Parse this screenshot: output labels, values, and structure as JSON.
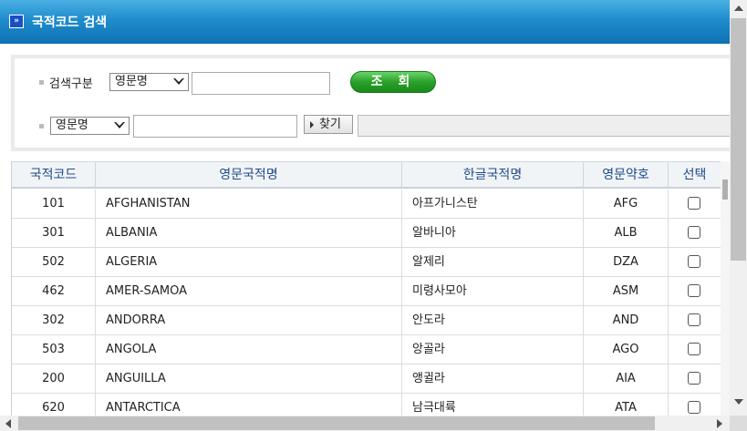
{
  "window": {
    "title": "국적코드 검색",
    "title_icon": "double-chevron-icon"
  },
  "search": {
    "label": "검색구분",
    "type_select": "영문명",
    "keyword_value": "",
    "query_button": "조 회",
    "filter_select": "영문명",
    "filter_value": "",
    "find_button": "찾기"
  },
  "table": {
    "headers": [
      "국적코드",
      "영문국적명",
      "한글국적명",
      "영문약호",
      "선택"
    ],
    "rows": [
      {
        "code": "101",
        "en": "AFGHANISTAN",
        "kr": "아프가니스탄",
        "abbr": "AFG"
      },
      {
        "code": "301",
        "en": "ALBANIA",
        "kr": "알바니아",
        "abbr": "ALB"
      },
      {
        "code": "502",
        "en": "ALGERIA",
        "kr": "알제리",
        "abbr": "DZA"
      },
      {
        "code": "462",
        "en": "AMER-SAMOA",
        "kr": "미령사모아",
        "abbr": "ASM"
      },
      {
        "code": "302",
        "en": "ANDORRA",
        "kr": "안도라",
        "abbr": "AND"
      },
      {
        "code": "503",
        "en": "ANGOLA",
        "kr": "앙골라",
        "abbr": "AGO"
      },
      {
        "code": "200",
        "en": "ANGUILLA",
        "kr": "앵귈라",
        "abbr": "AIA"
      },
      {
        "code": "620",
        "en": "ANTARCTICA",
        "kr": "남극대륙",
        "abbr": "ATA"
      }
    ]
  },
  "colors": {
    "title_bar": "#1f8ccc",
    "header_text": "#1e4b8a",
    "query_button": "#2aa12a"
  }
}
